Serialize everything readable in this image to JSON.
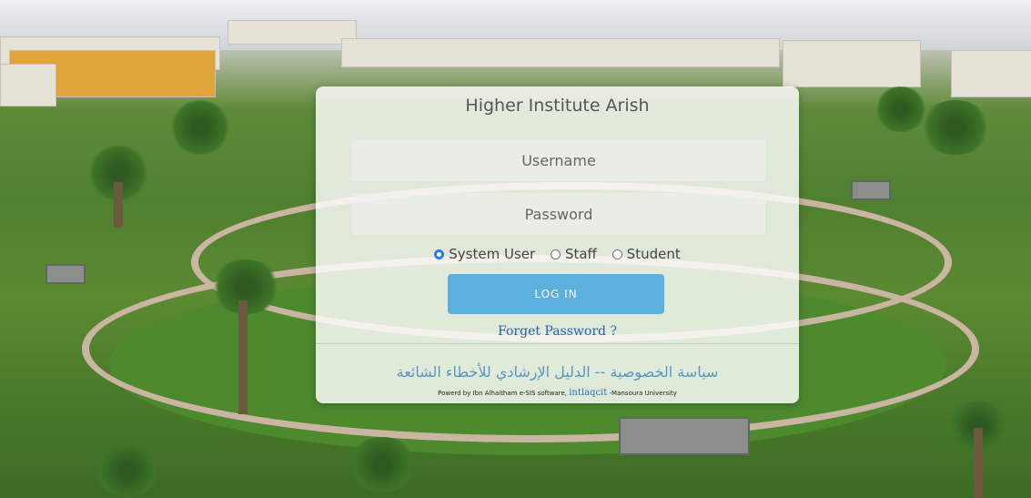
{
  "login": {
    "title": "Higher Institute Arish",
    "username_placeholder": "Username",
    "password_placeholder": "Password",
    "user_types": [
      {
        "label": "System User",
        "selected": true
      },
      {
        "label": "Staff",
        "selected": false
      },
      {
        "label": "Student",
        "selected": false
      }
    ],
    "login_label": "LOG IN",
    "forget_label": "Forget Password ?",
    "privacy_links_arabic": "سياسة الخصوصية -- الدليل الإرشادي للأخطاء الشائعة",
    "powered_prefix": "Powerd by Ibn Alhaitham e-SIS software,",
    "powered_link": "intlaqcit",
    "powered_suffix": "-Mansoura University"
  },
  "colors": {
    "button": "#5bb0de",
    "link": "#2e5db0",
    "arabic_link": "#5a96c2",
    "radio_selected": "#2a7fd8"
  }
}
